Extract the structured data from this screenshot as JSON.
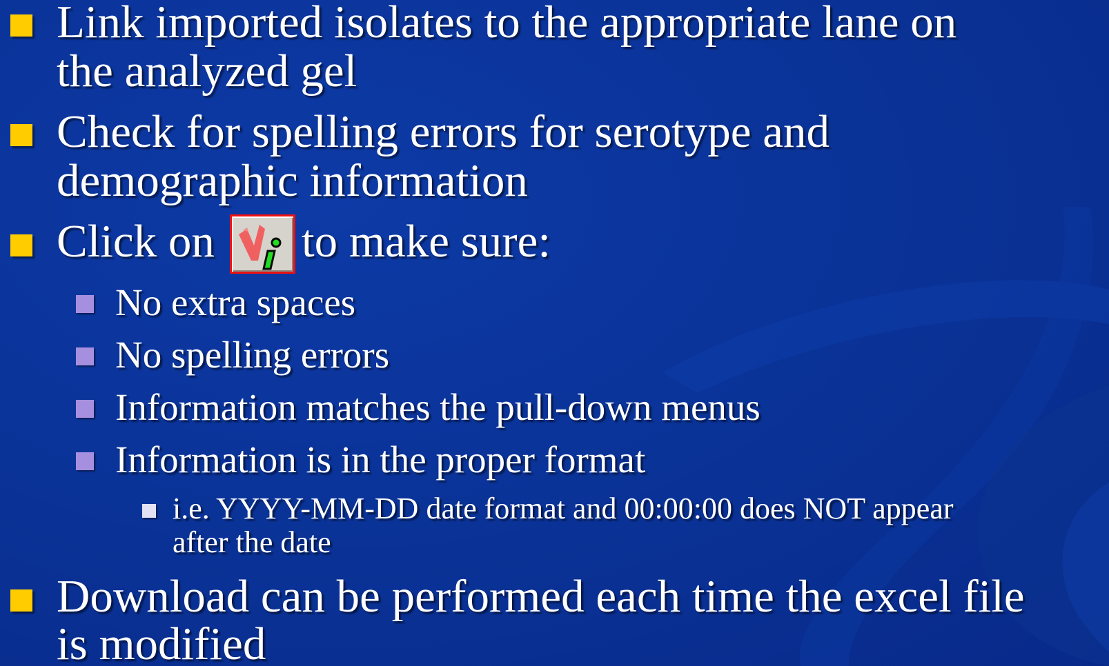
{
  "slide": {
    "bullets": [
      {
        "lines": [
          "Link imported isolates to the appropriate lane on",
          "the analyzed gel"
        ]
      },
      {
        "lines": [
          "Check for spelling errors for serotype and",
          "demographic information"
        ]
      },
      {
        "before_icon": "Click on",
        "icon": "check-validation-icon",
        "after_icon": "to make sure:",
        "sub_bullets": [
          "No extra spaces",
          "No spelling errors",
          "Information matches the pull-down menus",
          "Information is in the proper format"
        ],
        "sub_sub_bullet": {
          "lines": [
            "i.e. YYYY-MM-DD date format and 00:00:00 does NOT appear",
            "after the date"
          ]
        }
      },
      {
        "lines": [
          "Download can be performed each time the excel file",
          "is modified"
        ]
      }
    ]
  },
  "colors": {
    "background": "#0a3296",
    "level1_bullet": "#ffcc00",
    "level2_bullet": "#a78fe0",
    "level3_bullet": "#e2e2f4",
    "icon_border": "#ee1111"
  }
}
